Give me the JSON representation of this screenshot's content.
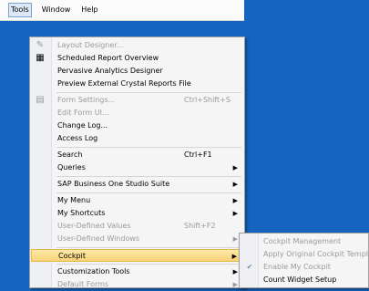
{
  "menubar": {
    "items": [
      {
        "label": "Tools",
        "active": true
      },
      {
        "label": "Window",
        "active": false
      },
      {
        "label": "Help",
        "active": false
      }
    ]
  },
  "tools_menu": {
    "items": [
      {
        "label": "Layout Designer...",
        "disabled": true,
        "icon": "pencil-icon"
      },
      {
        "label": "Scheduled Report Overview",
        "disabled": false,
        "icon": "report-calendar-icon"
      },
      {
        "label": "Pervasive Analytics Designer",
        "disabled": false
      },
      {
        "label": "Preview External Crystal Reports File",
        "disabled": false
      },
      {
        "label": "Form Settings...",
        "shortcut": "Ctrl+Shift+S",
        "disabled": true,
        "icon": "form-settings-icon"
      },
      {
        "label": "Edit Form UI...",
        "disabled": true
      },
      {
        "label": "Change Log...",
        "disabled": false
      },
      {
        "label": "Access Log",
        "disabled": false
      },
      {
        "label": "Search",
        "shortcut": "Ctrl+F1",
        "disabled": false
      },
      {
        "label": "Queries",
        "disabled": false,
        "submenu": true
      },
      {
        "label": "SAP Business One Studio Suite",
        "disabled": false,
        "submenu": true
      },
      {
        "label": "My Menu",
        "disabled": false,
        "submenu": true
      },
      {
        "label": "My Shortcuts",
        "disabled": false,
        "submenu": true
      },
      {
        "label": "User-Defined Values",
        "shortcut": "Shift+F2",
        "disabled": true
      },
      {
        "label": "User-Defined Windows",
        "disabled": true,
        "submenu": true
      },
      {
        "label": "Cockpit",
        "disabled": false,
        "submenu": true,
        "highlighted": true
      },
      {
        "label": "Customization Tools",
        "disabled": false,
        "submenu": true
      },
      {
        "label": "Default Forms",
        "disabled": true,
        "submenu": true
      }
    ]
  },
  "cockpit_submenu": {
    "items": [
      {
        "label": "Cockpit Management",
        "disabled": true
      },
      {
        "label": "Apply Original Cockpit Template",
        "disabled": true
      },
      {
        "label": "Enable My Cockpit",
        "disabled": true,
        "checked": true,
        "icon": "checkmark-icon"
      },
      {
        "label": "Count Widget Setup",
        "disabled": false
      }
    ]
  },
  "glyphs": {
    "submenu_arrow": "▶",
    "pencil": "✎",
    "report": "▦",
    "form": "▤",
    "check": "✔"
  }
}
